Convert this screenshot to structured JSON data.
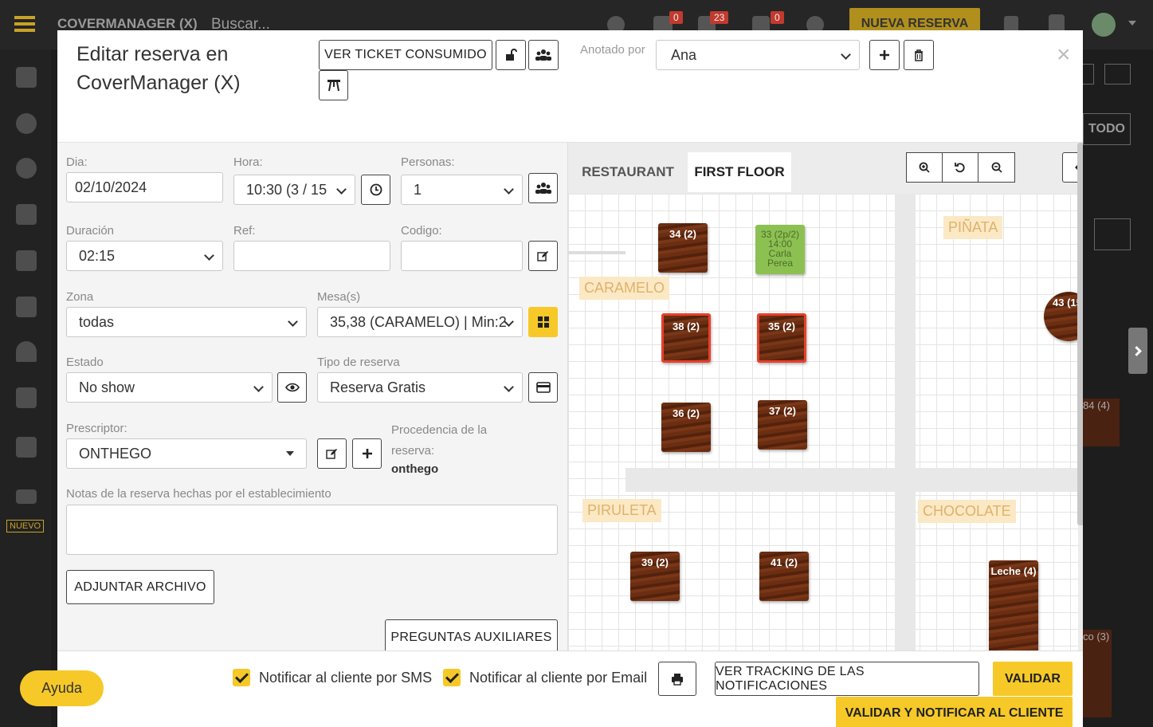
{
  "app": {
    "name": "COVERMANAGER (X)",
    "search_placeholder": "Buscar...",
    "new_reservation": "NUEVA RESERVA",
    "badges": [
      "0",
      "23",
      "0"
    ],
    "side_new_badge": "NUEVO",
    "bg_all_button": "TODO",
    "bg_table_84": "84 (4)",
    "bg_table_co": "co (3)"
  },
  "modal": {
    "title": "Editar reserva en CoverManager (X)",
    "ticket_button": "VER TICKET CONSUMIDO",
    "annotated_label": "Anotado por",
    "annotated_value": "Ana",
    "close": "×"
  },
  "form": {
    "dia_label": "Dia:",
    "dia_value": "02/10/2024",
    "hora_label": "Hora:",
    "hora_value": "10:30   (3 / 15",
    "personas_label": "Personas:",
    "personas_value": "1",
    "duracion_label": "Duración",
    "duracion_value": "02:15",
    "ref_label": "Ref:",
    "ref_value": "",
    "codigo_label": "Codigo:",
    "codigo_value": "",
    "zona_label": "Zona",
    "zona_value": "todas",
    "mesas_label": "Mesa(s)",
    "mesas_value": "35,38 (CARAMELO) | Min:2",
    "estado_label": "Estado",
    "estado_value": "No show",
    "tipo_label": "Tipo de reserva",
    "tipo_value": "Reserva Gratis",
    "prescriptor_label": "Prescriptor:",
    "prescriptor_value": "ONTHEGO",
    "procedencia_label": "Procedencia de la reserva:",
    "procedencia_value": "onthego",
    "notas_label": "Notas de la reserva hechas por el establecimiento",
    "notas_value": "",
    "adjuntar": "ADJUNTAR ARCHIVO",
    "preguntas": "PREGUNTAS AUXILIARES"
  },
  "floor": {
    "tabs": [
      "RESTAURANT",
      "FIRST FLOOR"
    ],
    "active_tab": "FIRST FLOOR",
    "zones": [
      "CARAMELO",
      "PIÑATA",
      "PIRULETA",
      "CHOCOLATE"
    ],
    "tables": [
      {
        "label": "34 (2)",
        "state": "normal"
      },
      {
        "label": "33 (2p/2) 14:00 Carla Perea",
        "state": "occupied"
      },
      {
        "label": "38 (2)",
        "state": "selected"
      },
      {
        "label": "35 (2)",
        "state": "selected"
      },
      {
        "label": "36 (2)",
        "state": "normal"
      },
      {
        "label": "37 (2)",
        "state": "normal"
      },
      {
        "label": "43 (15",
        "state": "normal"
      },
      {
        "label": "39 (2)",
        "state": "normal"
      },
      {
        "label": "41 (2)",
        "state": "normal"
      },
      {
        "label": "Leche (4)",
        "state": "normal"
      }
    ]
  },
  "footer": {
    "sms": "Notificar al cliente por SMS",
    "email": "Notificar al cliente por Email",
    "tracking": "VER TRACKING DE LAS NOTIFICACIONES",
    "validar": "VALIDAR",
    "validar_notificar": "VALIDAR Y NOTIFICAR AL CLIENTE"
  },
  "help": "Ayuda",
  "colors": {
    "accent": "#f6c928",
    "selected_border": "#e8402a",
    "occupied": "#8cc152"
  }
}
